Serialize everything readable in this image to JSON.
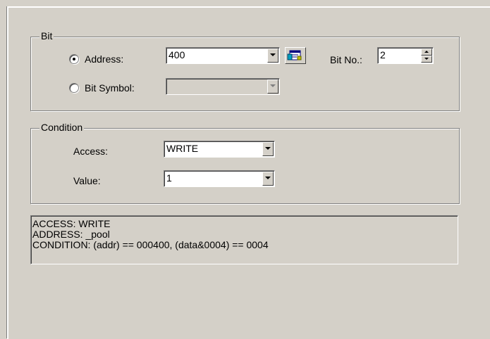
{
  "bit_group": {
    "title": "Bit",
    "address_label": "Address:",
    "address_value": "400",
    "bit_symbol_label": "Bit Symbol:",
    "bit_symbol_value": "",
    "bit_no_label": "Bit No.:",
    "bit_no_value": "2",
    "selected": "address"
  },
  "condition_group": {
    "title": "Condition",
    "access_label": "Access:",
    "access_value": "WRITE",
    "value_label": "Value:",
    "value_value": "1"
  },
  "summary": {
    "lines": [
      "ACCESS: WRITE",
      "ADDRESS: _pool",
      "CONDITION: (addr) == 000400, (data&0004) == 0004"
    ]
  },
  "icons": {
    "symbol_browse": "address-book-icon"
  }
}
